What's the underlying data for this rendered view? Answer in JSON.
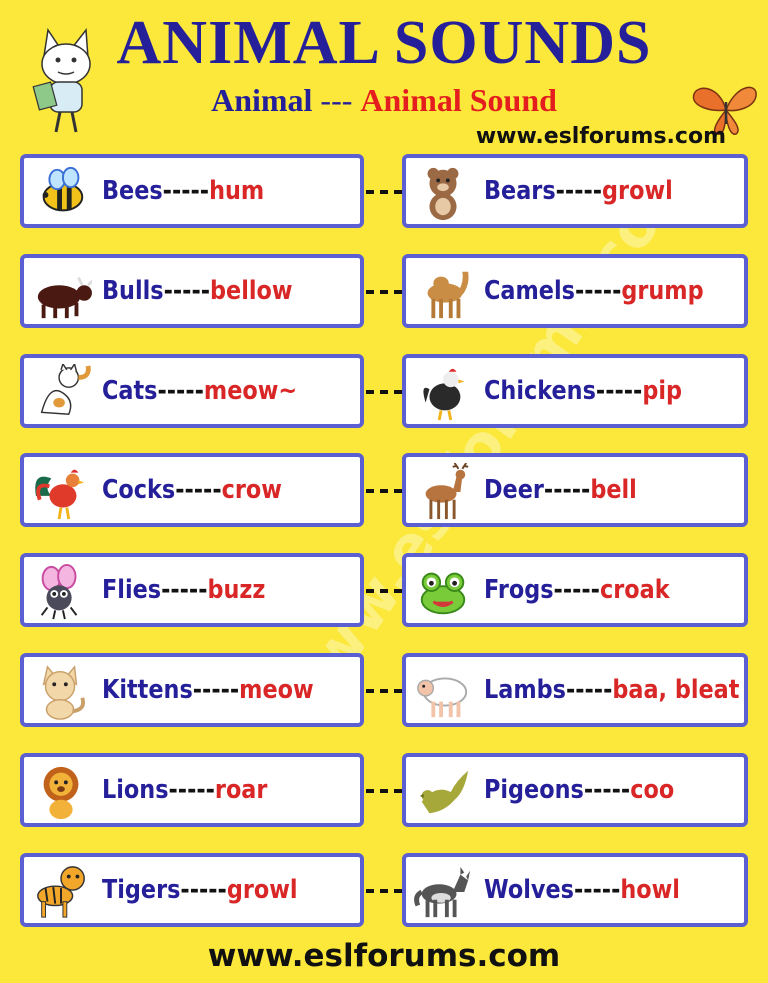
{
  "header": {
    "title": "ANIMAL SOUNDS",
    "subtitle_animal": "Animal",
    "subtitle_sep": " --- ",
    "subtitle_sound": "Animal Sound",
    "site_top": "www.eslforums.com"
  },
  "watermark": "www.eslforums.com",
  "separator": "-----",
  "pairs": [
    {
      "animal": "Bees",
      "sound": "hum",
      "icon": "bee-icon"
    },
    {
      "animal": "Bears",
      "sound": "growl",
      "icon": "bear-icon"
    },
    {
      "animal": "Bulls",
      "sound": "bellow",
      "icon": "bull-icon"
    },
    {
      "animal": "Camels",
      "sound": "grump",
      "icon": "camel-icon"
    },
    {
      "animal": "Cats",
      "sound": "meow~",
      "icon": "cat-icon"
    },
    {
      "animal": "Chickens",
      "sound": "pip",
      "icon": "chicken-icon"
    },
    {
      "animal": "Cocks",
      "sound": "crow",
      "icon": "rooster-icon"
    },
    {
      "animal": "Deer",
      "sound": "bell",
      "icon": "deer-icon"
    },
    {
      "animal": "Flies",
      "sound": "buzz",
      "icon": "fly-icon"
    },
    {
      "animal": "Frogs",
      "sound": "croak",
      "icon": "frog-icon"
    },
    {
      "animal": "Kittens",
      "sound": "meow",
      "icon": "kitten-icon"
    },
    {
      "animal": "Lambs",
      "sound": "baa, bleat",
      "icon": "lamb-icon"
    },
    {
      "animal": "Lions",
      "sound": "roar",
      "icon": "lion-icon"
    },
    {
      "animal": "Pigeons",
      "sound": "coo",
      "icon": "pigeon-icon"
    },
    {
      "animal": "Tigers",
      "sound": "growl",
      "icon": "tiger-icon"
    },
    {
      "animal": "Wolves",
      "sound": "howl",
      "icon": "wolf-icon"
    }
  ],
  "footer": {
    "site": "www.eslforums.com"
  },
  "colors": {
    "background": "#fbe83a",
    "animal_text": "#25209a",
    "sound_text": "#d92626",
    "card_border": "#5b5fd1"
  }
}
